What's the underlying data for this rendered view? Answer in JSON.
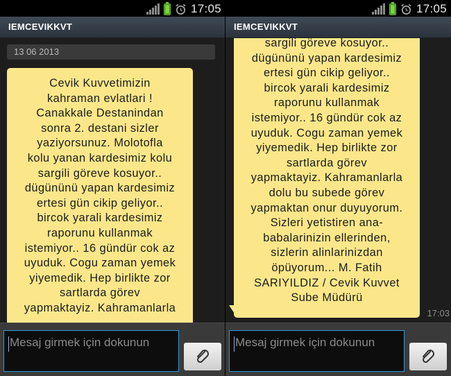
{
  "status_bar": {
    "time": "17:05",
    "icons": [
      "signal-icon",
      "battery-icon",
      "alarm-icon"
    ]
  },
  "conversation": {
    "title": "IEMCEVIKKVT"
  },
  "date_header": "13 06 2013",
  "message_left_lines": [
    "Cevik Kuvvetimizin",
    "kahraman evlatlari !",
    "Canakkale Destanindan",
    "sonra 2. destani sizler",
    "yaziyorsunuz. Molotofla",
    "kolu yanan kardesimiz kolu",
    "sargili göreve kosuyor..",
    "dügününü yapan kardesimiz",
    "ertesi gün cikip geliyor..",
    "bircok yarali kardesimiz",
    "raporunu kullanmak",
    "istemiyor.. 16 gündür cok az",
    "uyuduk. Cogu zaman yemek",
    "yiyemedik. Hep birlikte zor",
    "sartlarda görev",
    "yapmaktayiz. Kahramanlarla"
  ],
  "message_right_lines": [
    "sargili göreve kosuyor..",
    "dügününü yapan kardesimiz",
    "ertesi gün cikip geliyor..",
    "bircok yarali kardesimiz",
    "raporunu kullanmak",
    "istemiyor.. 16 gündür cok az",
    "uyuduk. Cogu zaman yemek",
    "yiyemedik. Hep birlikte zor",
    "sartlarda görev",
    "yapmaktayiz. Kahramanlarla",
    "dolu bu subede görev",
    "yapmaktan onur duyuyorum.",
    "Sizleri yetistiren ana-",
    "babalarinizin ellerinden,",
    "sizlerin alinlarinizdan",
    "öpüyorum... M. Fatih",
    "SARIYILDIZ / Cevik Kuvvet",
    "Sube Müdürü"
  ],
  "message_time": "17:03",
  "composer": {
    "placeholder": "Mesaj girmek için dokunun",
    "attach_icon": "paperclip-icon"
  },
  "colors": {
    "bubble": "#fbe78a",
    "titlebar": "#3f4a56",
    "input_border": "#2f9ad6",
    "background": "#1d1d1d"
  }
}
